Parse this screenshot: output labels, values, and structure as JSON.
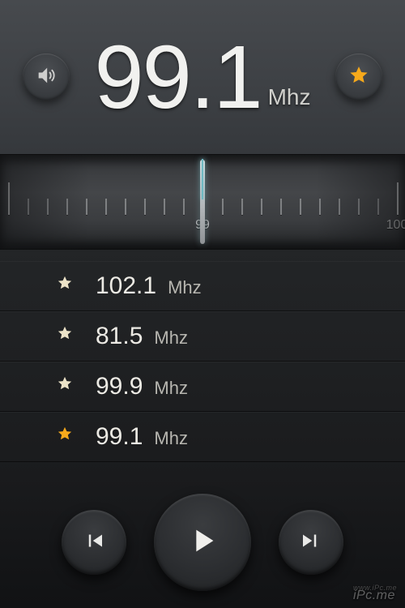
{
  "colors": {
    "accent_star": "#f6a91b",
    "needle_glow": "#6fb9c2"
  },
  "current": {
    "frequency": "99.1",
    "unit": "Mhz"
  },
  "dial": {
    "center_value": 99,
    "labels": {
      "center": "99",
      "right": "100"
    }
  },
  "favorites": [
    {
      "frequency": "102.1",
      "unit": "Mhz",
      "active": false
    },
    {
      "frequency": "81.5",
      "unit": "Mhz",
      "active": false
    },
    {
      "frequency": "99.9",
      "unit": "Mhz",
      "active": false
    },
    {
      "frequency": "99.1",
      "unit": "Mhz",
      "active": true
    }
  ],
  "icons": {
    "speaker": "speaker-icon",
    "favorite": "star-icon",
    "prev": "prev-track-icon",
    "play": "play-icon",
    "next": "next-track-icon"
  },
  "watermark": {
    "small": "www.iPc.me",
    "main": "iPc.me"
  }
}
